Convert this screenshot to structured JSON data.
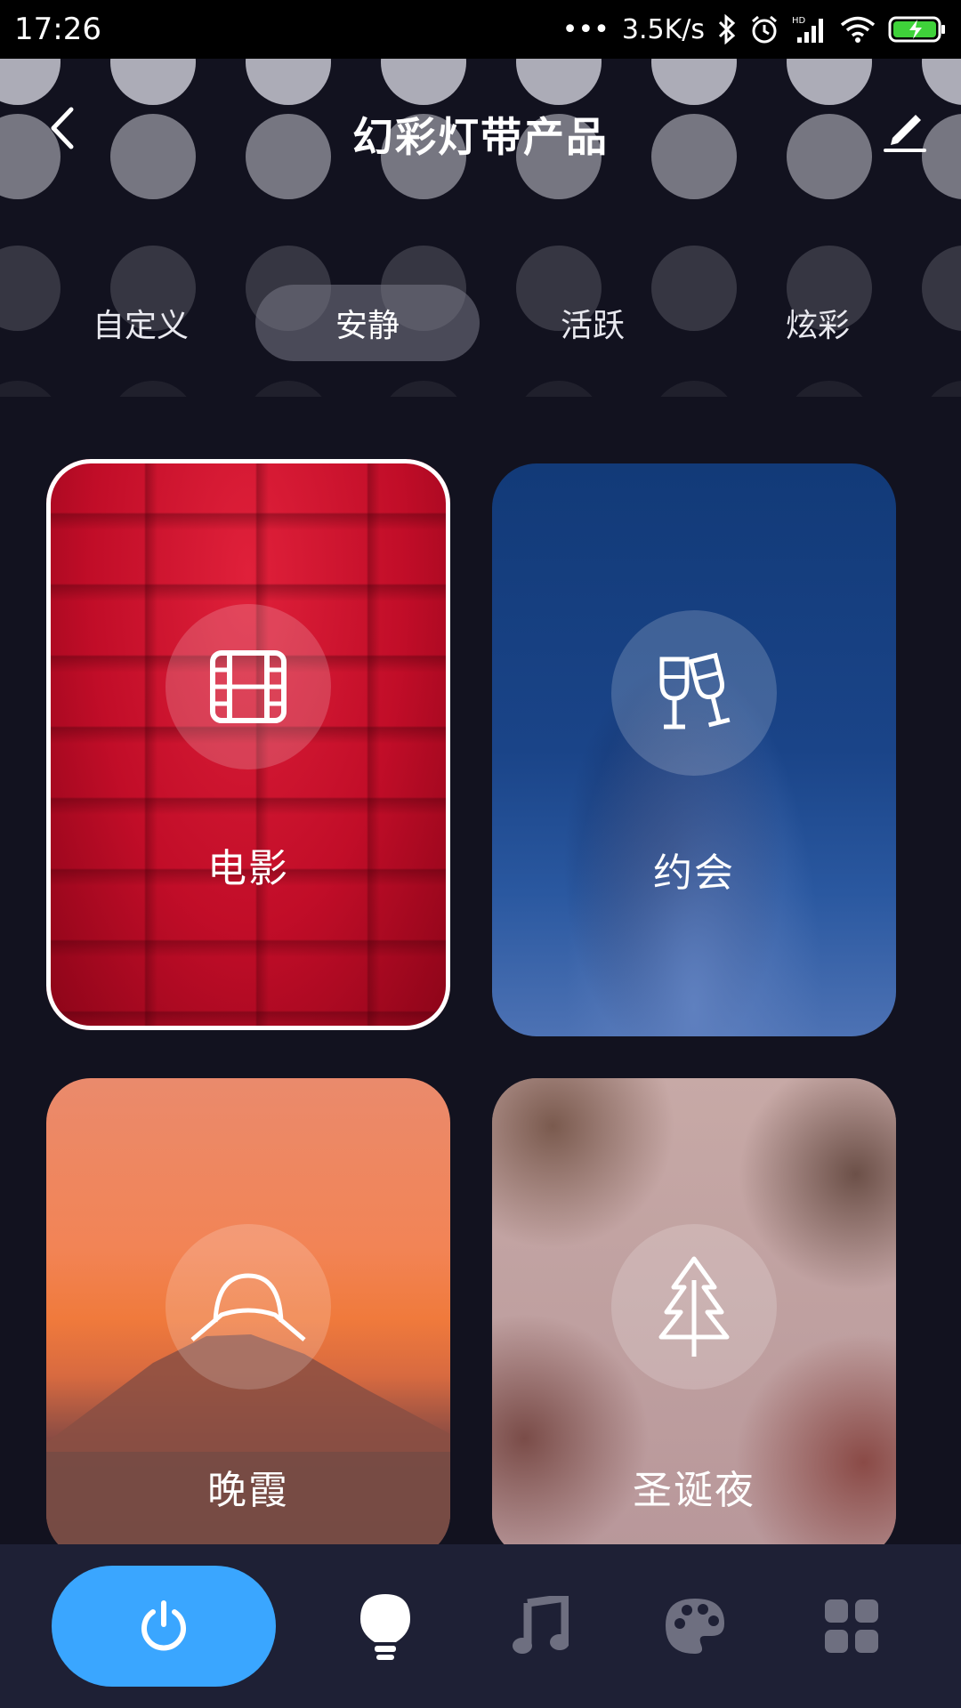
{
  "status_bar": {
    "time": "17:26",
    "net_speed": "3.5K/s",
    "icons": [
      "more-dots-icon",
      "bluetooth-icon",
      "alarm-icon",
      "hd-signal-icon",
      "wifi-icon",
      "battery-charging-icon"
    ]
  },
  "header": {
    "title": "幻彩灯带产品",
    "back_icon": "back-arrow-icon",
    "edit_icon": "edit-pencil-icon"
  },
  "tabs": [
    {
      "label": "自定义",
      "active": false
    },
    {
      "label": "安静",
      "active": true
    },
    {
      "label": "活跃",
      "active": false
    },
    {
      "label": "炫彩",
      "active": false
    }
  ],
  "scenes": [
    {
      "label": "电影",
      "icon": "film-icon",
      "selected": true
    },
    {
      "label": "约会",
      "icon": "champagne-glasses-icon",
      "selected": false
    },
    {
      "label": "晚霞",
      "icon": "sunset-mountain-icon",
      "selected": false
    },
    {
      "label": "圣诞夜",
      "icon": "christmas-tree-icon",
      "selected": false
    }
  ],
  "bottom_nav": [
    {
      "name": "power",
      "icon": "power-icon",
      "active": true
    },
    {
      "name": "light",
      "icon": "lightbulb-icon",
      "active": false
    },
    {
      "name": "music",
      "icon": "music-note-icon",
      "active": false
    },
    {
      "name": "palette",
      "icon": "palette-icon",
      "active": false
    },
    {
      "name": "more",
      "icon": "grid-icon",
      "active": false
    }
  ],
  "colors": {
    "background": "#12121f",
    "accent": "#3aa6ff",
    "nav_bg": "#1e2035"
  }
}
